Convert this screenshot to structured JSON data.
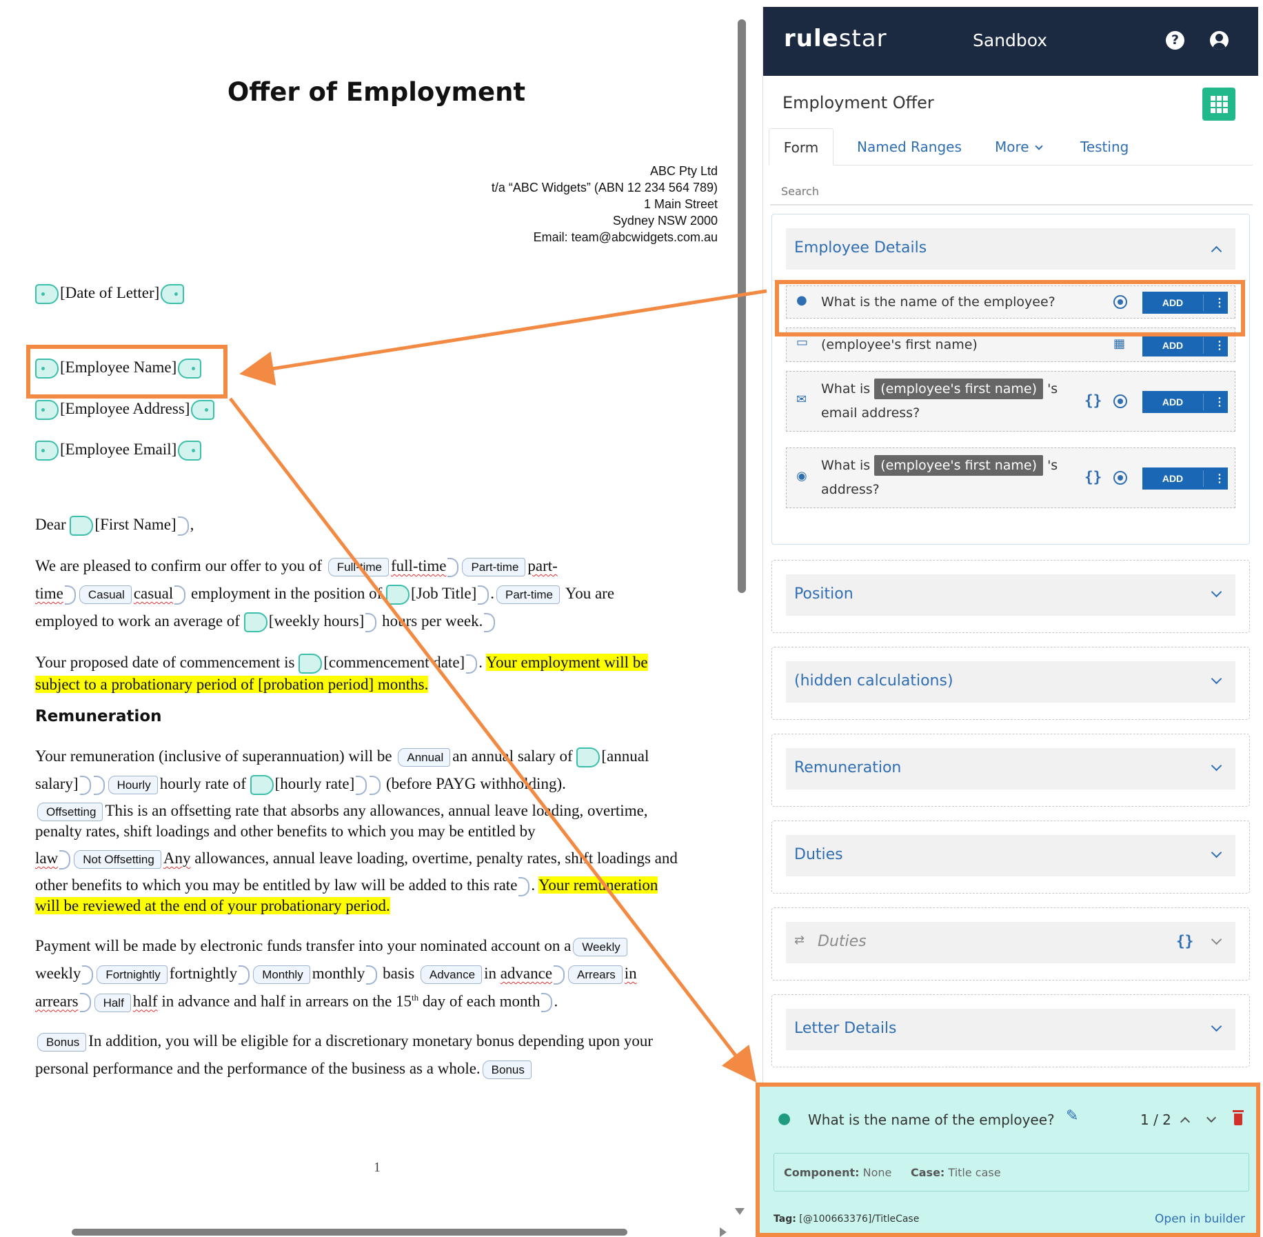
{
  "document": {
    "title": "Offer of Employment",
    "address_lines": [
      "ABC Pty Ltd",
      "t/a “ABC Widgets” (ABN 12 234 564 789)",
      "1 Main Street",
      "Sydney NSW 2000",
      "Email: team@abcwidgets.com.au"
    ],
    "fields": {
      "date_of_letter": "[Date of Letter]",
      "employee_name": "[Employee Name]",
      "employee_address": "[Employee Address]",
      "employee_email": "[Employee Email]",
      "first_name": "[First Name]",
      "job_title": "[Job Title]",
      "weekly_hours": "[weekly hours]",
      "commencement_date": "[commencement date]",
      "annual_salary_1": "[annual",
      "annual_salary_2": "salary]",
      "hourly_rate": "[hourly rate]"
    },
    "tags": {
      "full_time": "Full-time",
      "part_time": "Part-time",
      "casual": "Casual",
      "part_time_2": "Part-time",
      "annual": "Annual",
      "hourly": "Hourly",
      "offsetting": "Offsetting",
      "not_offsetting": "Not Offsetting",
      "weekly": "Weekly",
      "fortnightly": "Fortnightly",
      "monthly": "Monthly",
      "advance": "Advance",
      "arrears": "Arrears",
      "half": "Half",
      "bonus": "Bonus",
      "bonus_end": "Bonus"
    },
    "text": {
      "dear": "Dear",
      "comma": ",",
      "p1_a": "We are pleased to confirm our offer to you of",
      "p1_full_time": "full-time",
      "p1_part": "part-",
      "p1_time": "time",
      "p1_casual": "casual",
      "p1_b": "employment in the position of",
      "p1_c": ".",
      "p1_d": "You are",
      "p1_e": "employed to work an average of",
      "p1_f": "hours per week.",
      "p2_a": "Your proposed date of commencement is",
      "p2_b": ".",
      "p2_hl1": "Your employment will be",
      "p2_hl2": "subject to a probationary period of [probation period] months.",
      "remuneration_heading": "Remuneration",
      "r1_a": "Your remuneration (inclusive of superannuation) will be",
      "r1_b": "an annual salary of",
      "r1_c": "hourly rate of",
      "r1_d": "(before PAYG withholding).",
      "r2_a": "This is an offsetting rate that absorbs any allowances, annual leave loading, overtime,",
      "r2_b": "penalty rates, shift loadings and other benefits to which you may be entitled by",
      "r2_law": "law",
      "r2_any": "Any",
      "r2_c": "allowances, annual leave loading, overtime, penalty rates, shift loadings and",
      "r2_d": "other benefits to which you may be entitled by law will be added to this rate",
      "r2_e": ".",
      "r2_hl1": "Your remuneration",
      "r2_hl2": "will be reviewed at the end of your probationary period.",
      "pay_a": "Payment will be made by electronic funds transfer into your nominated account on a",
      "pay_weekly": "weekly",
      "pay_fortnightly": "fortnightly",
      "pay_monthly": "monthly",
      "pay_basis": "basis",
      "pay_in": "in",
      "pay_advance": "advance",
      "pay_in2": "in",
      "pay_arrears": "arrears",
      "pay_half": "half",
      "pay_b": "in advance and half in arrears on the 15",
      "pay_th": "th",
      "pay_c": "day of each month",
      "pay_d": ".",
      "bonus_a": "In addition, you will be eligible for a discretionary monetary bonus depending upon your",
      "bonus_b": "personal performance and the performance of the business as a whole."
    },
    "page_number": "1"
  },
  "panel": {
    "logo_bold": "rule",
    "logo_light": "star",
    "environment": "Sandbox",
    "help_icon": "?",
    "title": "Employment Offer",
    "tabs": [
      {
        "label": "Form"
      },
      {
        "label": "Named Ranges"
      },
      {
        "label": "More"
      },
      {
        "label": "Testing"
      }
    ],
    "search_placeholder": "Search",
    "sections": [
      {
        "label": "Employee Details"
      },
      {
        "label": "Position"
      },
      {
        "label": "(hidden calculations)"
      },
      {
        "label": "Remuneration"
      },
      {
        "label": "Duties"
      },
      {
        "label": "Duties"
      },
      {
        "label": "Letter Details"
      }
    ],
    "questions": [
      {
        "text": "What is the name of the employee?",
        "add": "ADD"
      },
      {
        "text": "(employee's first name)",
        "add": "ADD"
      },
      {
        "pre": "What is",
        "pill": "(employee's first name)",
        "post": "'s",
        "line2": "email address?",
        "add": "ADD"
      },
      {
        "pre": "What is",
        "pill": "(employee's first name)",
        "post": "'s",
        "line2": "address?",
        "add": "ADD"
      }
    ],
    "braces_icon": "{}",
    "more_icon": "⋮"
  },
  "inspector": {
    "question": "What is the name of the employee?",
    "pager": "1 / 2",
    "component_label": "Component:",
    "component_value": "None",
    "case_label": "Case:",
    "case_value": "Title case",
    "tag_label": "Tag:",
    "tag_value": "[@100663376]/TitleCase",
    "open_link": "Open in builder"
  },
  "colors": {
    "accent_orange": "#f28a43",
    "field_teal": "#3bbfaa",
    "link_blue": "#2f6eb2",
    "button_blue": "#1a67b5",
    "topbar": "#1b2a41",
    "highlight_yellow": "#ffff00",
    "inspector_bg": "#c9f5ee"
  }
}
